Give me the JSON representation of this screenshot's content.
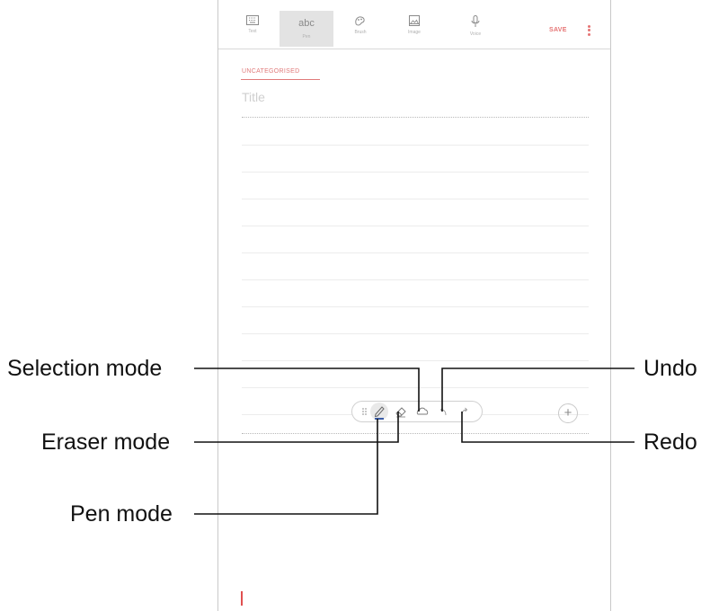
{
  "toolbar": {
    "tools": [
      {
        "icon": "keyboard-icon",
        "label": "Text"
      },
      {
        "icon": "abc",
        "label": "Pen"
      },
      {
        "icon": "brush-icon",
        "label": "Brush"
      },
      {
        "icon": "image-icon",
        "label": "Image"
      },
      {
        "icon": "microphone-icon",
        "label": "Voice"
      }
    ],
    "save_label": "SAVE"
  },
  "note": {
    "category": "UNCATEGORISED",
    "title_placeholder": "Title"
  },
  "pen_toolbar": {
    "items": [
      "drag-handle-icon",
      "pen-icon",
      "eraser-icon",
      "selection-icon",
      "undo-icon",
      "redo-icon"
    ],
    "add_symbol": "+"
  },
  "callouts": {
    "selection_mode": "Selection mode",
    "eraser_mode": "Eraser mode",
    "pen_mode": "Pen mode",
    "undo": "Undo",
    "redo": "Redo"
  },
  "colors": {
    "accent": "#e57373",
    "callout_line": "#111111"
  }
}
